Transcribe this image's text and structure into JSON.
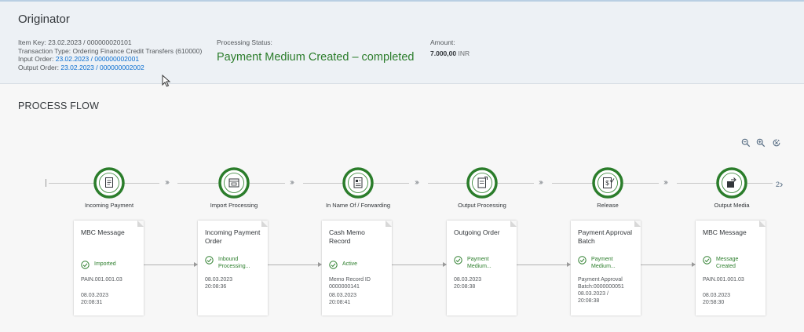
{
  "header": {
    "title": "Originator",
    "item_key": "Item Key: 23.02.2023 / 000000020101",
    "transaction_type": "Transaction Type: Ordering Finance Credit Transfers (610000)",
    "input_order_label": "Input Order:",
    "input_order_value": "23.02.2023 / 000000002001",
    "output_order_label": "Output Order:",
    "output_order_value": "23.02.2023 / 000000002002",
    "processing_status_label": "Processing Status:",
    "processing_status_value": "Payment Medium Created – completed",
    "amount_label": "Amount:",
    "amount_value": "7.000,00",
    "amount_currency": "INR"
  },
  "process_flow": {
    "title": "PROCESS FLOW",
    "more_count": "2",
    "lanes": [
      {
        "label": "Incoming Payment",
        "icon": "document-icon"
      },
      {
        "label": "Import Processing",
        "icon": "inbox-icon"
      },
      {
        "label": "In Name Of / Forwarding",
        "icon": "memo-icon"
      },
      {
        "label": "Output Processing",
        "icon": "outgoing-doc-icon"
      },
      {
        "label": "Release",
        "icon": "approval-icon"
      },
      {
        "label": "Output Media",
        "icon": "export-icon"
      }
    ],
    "cards": [
      {
        "title": "MBC Message",
        "status": "Imported",
        "line1": "PAIN.001.001.03",
        "line2": "",
        "line3": "08.03.2023",
        "line4": "20:08:31"
      },
      {
        "title": "Incoming Payment Order",
        "status": "Inbound Processing...",
        "line1": "08.03.2023",
        "line2": "20:08:36",
        "line3": "",
        "line4": ""
      },
      {
        "title": "Cash Memo Record",
        "status": "Active",
        "line1": "Memo Record ID",
        "line2": "0000000141",
        "line3": "08.03.2023",
        "line4": "20:08:41"
      },
      {
        "title": "Outgoing Order",
        "status": "Payment Medium...",
        "line1": "08.03.2023",
        "line2": "20:08:38",
        "line3": "",
        "line4": ""
      },
      {
        "title": "Payment Approval Batch",
        "status": "Payment Medium...",
        "line1": "Payment Approval",
        "line2": "Batch:0000000051",
        "line3": "08.03.2023 /",
        "line4": "20:08:38"
      },
      {
        "title": "MBC Message",
        "status": "Message Created",
        "line1": "PAIN.001.001.03",
        "line2": "",
        "line3": "08.03.2023",
        "line4": "20:58:30"
      }
    ]
  },
  "colors": {
    "success": "#2b7d2b",
    "link": "#0a6ed1",
    "header_bg": "#edf1f5"
  }
}
